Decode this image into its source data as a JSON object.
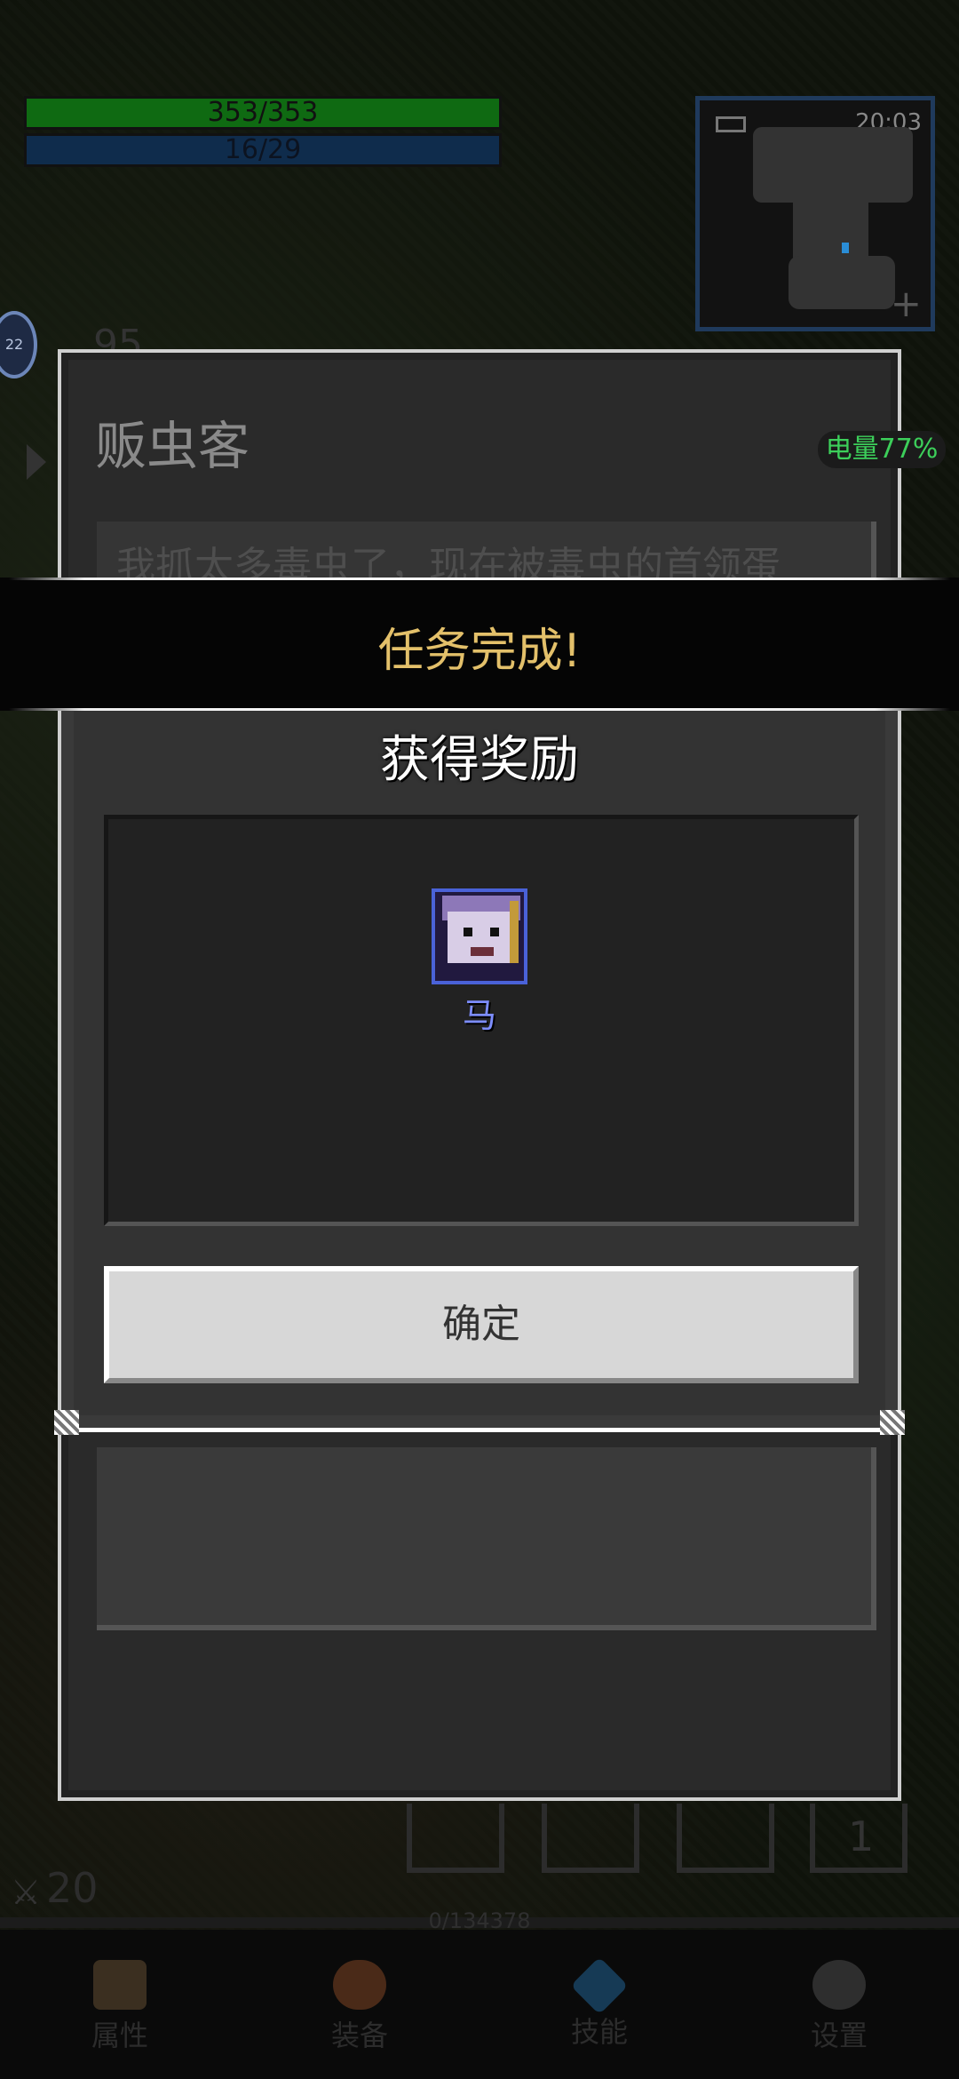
{
  "hud": {
    "hp": "353/353",
    "mp": "16/29"
  },
  "minimap": {
    "time": "20:03",
    "plus": "+"
  },
  "level_badge": "22",
  "ghost_number": "95",
  "npc_dialog": {
    "name": "贩虫客",
    "text": "我抓太多毒虫了，现在被毒虫的首领蛋"
  },
  "battery": "电量77%",
  "banner": {
    "title": "任务完成!"
  },
  "reward": {
    "title": "获得奖励",
    "item_name": "马",
    "confirm_label": "确定"
  },
  "bottom": {
    "slot_number": "1",
    "weapon_count": "20",
    "xp_text": "0/134378"
  },
  "nav": [
    {
      "label": "属性",
      "icon": "helmet-icon"
    },
    {
      "label": "装备",
      "icon": "bag-icon"
    },
    {
      "label": "技能",
      "icon": "crystal-icon"
    },
    {
      "label": "设置",
      "icon": "gear-icon"
    }
  ]
}
